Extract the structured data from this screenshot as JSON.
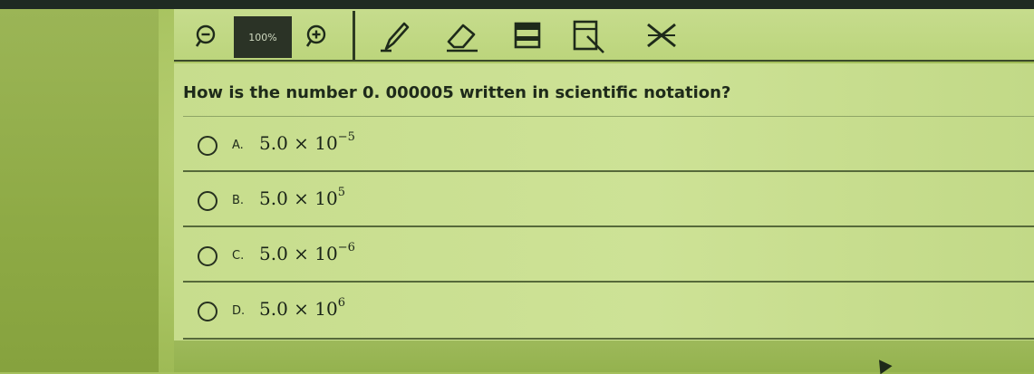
{
  "toolbar": {
    "zoom_out_icon": "zoom-out-icon",
    "zoom_level": "100%",
    "zoom_in_icon": "zoom-in-icon",
    "tools": [
      "pencil-icon",
      "eraser-icon",
      "highlighter-icon",
      "line-reader-icon",
      "answer-eliminator-icon"
    ]
  },
  "question": {
    "text": "How is the number 0. 000005 written in scientific notation?"
  },
  "choices": [
    {
      "letter": "A.",
      "base": "5.0 × 10",
      "exp": "−5"
    },
    {
      "letter": "B.",
      "base": "5.0 × 10",
      "exp": "5"
    },
    {
      "letter": "C.",
      "base": "5.0 × 10",
      "exp": "−6"
    },
    {
      "letter": "D.",
      "base": "5.0 × 10",
      "exp": "6"
    }
  ],
  "colors": {
    "background": "#a9c461",
    "content_bg": "#cde296",
    "text": "#1e2a1a",
    "zoom_badge": "#2b3326"
  }
}
